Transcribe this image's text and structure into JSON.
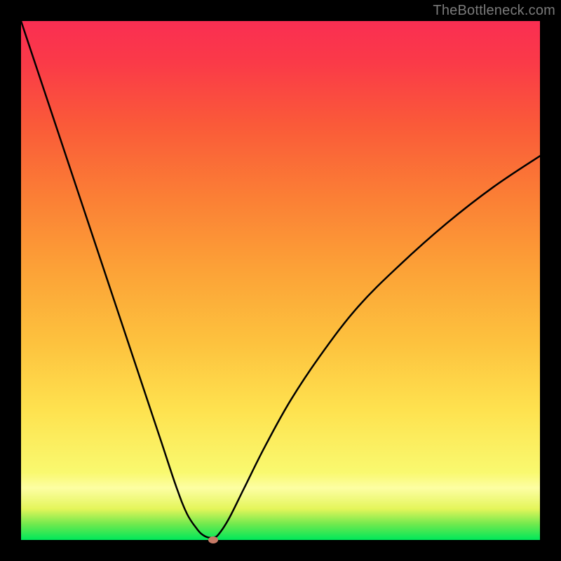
{
  "watermark": "TheBottleneck.com",
  "chart_data": {
    "type": "line",
    "title": "",
    "xlabel": "",
    "ylabel": "",
    "xlim": [
      0,
      100
    ],
    "ylim": [
      0,
      100
    ],
    "grid": false,
    "legend": false,
    "series": [
      {
        "name": "bottleneck-curve",
        "x": [
          0,
          3,
          6,
          9,
          12,
          15,
          18,
          21,
          24,
          27,
          30,
          32,
          34,
          35,
          36,
          37,
          38,
          40,
          43,
          47,
          52,
          58,
          65,
          73,
          82,
          91,
          100
        ],
        "y": [
          100,
          91,
          82,
          73,
          64,
          55,
          46,
          37,
          28,
          19,
          10,
          5,
          2,
          1,
          0.5,
          0.5,
          1,
          4,
          10,
          18,
          27,
          36,
          45,
          53,
          61,
          68,
          74
        ]
      }
    ],
    "marker": {
      "x": 37,
      "y": 0,
      "color": "#c77a66"
    },
    "gradient_stops": [
      {
        "pos": 0,
        "color": "#00e85a"
      },
      {
        "pos": 10,
        "color": "#fdfea3"
      },
      {
        "pos": 25,
        "color": "#fee24f"
      },
      {
        "pos": 50,
        "color": "#fca237"
      },
      {
        "pos": 80,
        "color": "#fa5a39"
      },
      {
        "pos": 100,
        "color": "#fa2e52"
      }
    ]
  }
}
